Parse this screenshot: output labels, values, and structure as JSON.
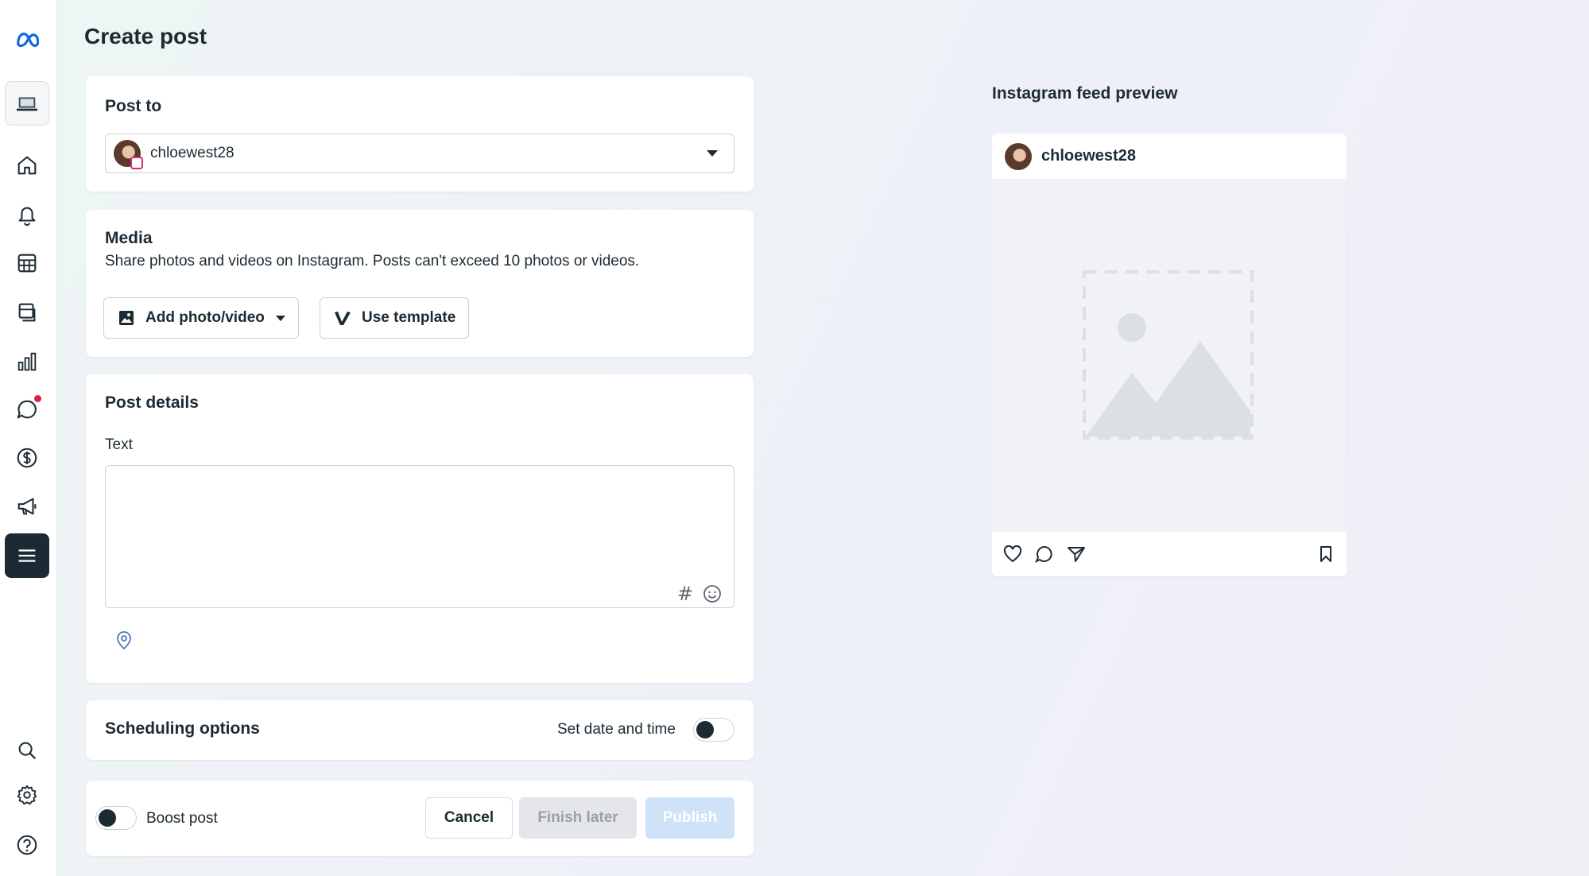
{
  "page": {
    "title": "Create post"
  },
  "sidebar": {
    "items": [
      {
        "name": "meta-logo",
        "icon": "meta-logo-icon"
      },
      {
        "name": "sidebar-item-desktop",
        "icon": "laptop-icon"
      },
      {
        "name": "sidebar-item-home",
        "icon": "home-icon"
      },
      {
        "name": "sidebar-item-notifications",
        "icon": "bell-icon"
      },
      {
        "name": "sidebar-item-table",
        "icon": "table-icon"
      },
      {
        "name": "sidebar-item-content",
        "icon": "pages-icon"
      },
      {
        "name": "sidebar-item-insights",
        "icon": "bar-chart-icon"
      },
      {
        "name": "sidebar-item-inbox",
        "icon": "chat-bubble-icon"
      },
      {
        "name": "sidebar-item-monetization",
        "icon": "dollar-icon"
      },
      {
        "name": "sidebar-item-ads",
        "icon": "megaphone-icon"
      },
      {
        "name": "sidebar-item-menu",
        "icon": "hamburger-menu-icon"
      },
      {
        "name": "sidebar-item-search",
        "icon": "search-icon"
      },
      {
        "name": "sidebar-item-settings",
        "icon": "gear-icon"
      },
      {
        "name": "sidebar-item-help",
        "icon": "help-icon"
      }
    ]
  },
  "post_to": {
    "title": "Post to",
    "selected_account": "chloewest28"
  },
  "media": {
    "title": "Media",
    "description": "Share photos and videos on Instagram. Posts can't exceed 10 photos or videos.",
    "add_button": "Add photo/video",
    "template_button": "Use template"
  },
  "post_details": {
    "title": "Post details",
    "text_label": "Text",
    "text_value": "",
    "hash_symbol": "#"
  },
  "scheduling": {
    "title": "Scheduling options",
    "toggle_label": "Set date and time",
    "toggle_on": false
  },
  "footer": {
    "boost_label": "Boost post",
    "boost_on": false,
    "cancel_label": "Cancel",
    "finish_label": "Finish later",
    "publish_label": "Publish"
  },
  "preview": {
    "title": "Instagram feed preview",
    "username": "chloewest28"
  },
  "colors": {
    "accent": "#1877f2",
    "dark": "#1c2b33",
    "notification": "#e41e3f",
    "publish_disabled": "#cfe2fa"
  }
}
